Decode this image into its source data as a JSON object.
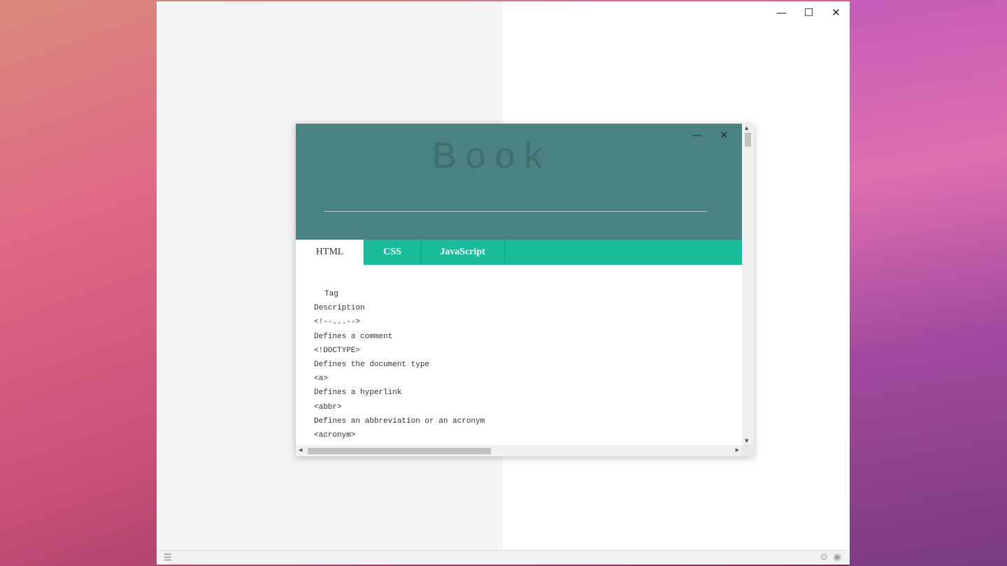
{
  "app": {
    "controls": {
      "minimize": "—",
      "maximize": "☐",
      "close": "✕"
    },
    "status": {
      "menu": "☰",
      "icon1": "⊙",
      "icon2": "◉"
    }
  },
  "book": {
    "title": "Book",
    "controls": {
      "minimize": "—",
      "close": "✕"
    },
    "tabs": [
      {
        "label": "HTML",
        "active": true
      },
      {
        "label": "CSS",
        "active": false
      },
      {
        "label": "JavaScript",
        "active": false
      }
    ],
    "lines": [
      "Tag",
      "Description",
      "<!--...-->",
      "Defines a comment",
      "<!DOCTYPE>",
      "Defines the document type",
      "<a>",
      "Defines a hyperlink",
      "<abbr>",
      "Defines an abbreviation or an acronym",
      "<acronym>"
    ],
    "scroll": {
      "up": "▲",
      "down": "▼",
      "left": "◀",
      "right": "▶"
    }
  },
  "colors": {
    "header": "#4a8182",
    "tabs": "#1abc9c",
    "title": "#3f6e6f"
  }
}
